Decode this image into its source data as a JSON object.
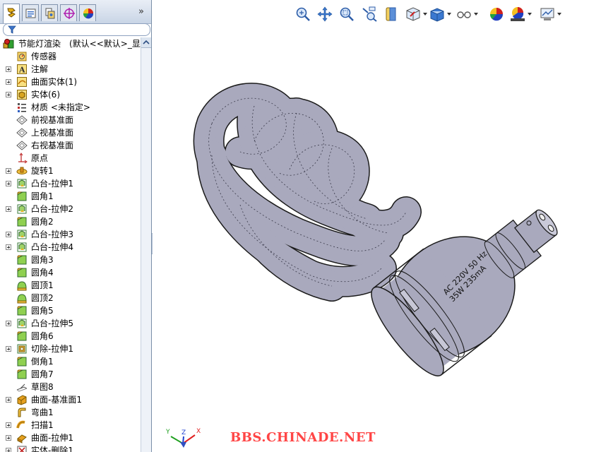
{
  "feature_manager": {
    "tabs": [
      {
        "name": "feature-manager-tab",
        "icon": "feature-tree-icon"
      },
      {
        "name": "property-manager-tab",
        "icon": "property-icon"
      },
      {
        "name": "configuration-manager-tab",
        "icon": "configuration-icon"
      },
      {
        "name": "dimxpert-tab",
        "icon": "target-icon"
      },
      {
        "name": "display-manager-tab",
        "icon": "appearance-icon"
      }
    ],
    "more_label": "»",
    "root_label": "节能灯渲染　(默认<<默认>_显示",
    "items": [
      {
        "label": "传感器",
        "icon": "sensor-icon",
        "expand": false
      },
      {
        "label": "注解",
        "icon": "annotation-icon",
        "expand": true
      },
      {
        "label": "曲面实体(1)",
        "icon": "surface-body-icon",
        "expand": true
      },
      {
        "label": "实体(6)",
        "icon": "solid-body-icon",
        "expand": true
      },
      {
        "label": "材质 <未指定>",
        "icon": "material-icon",
        "expand": false
      },
      {
        "label": "前视基准面",
        "icon": "plane-icon",
        "expand": false
      },
      {
        "label": "上视基准面",
        "icon": "plane-icon",
        "expand": false
      },
      {
        "label": "右视基准面",
        "icon": "plane-icon",
        "expand": false
      },
      {
        "label": "原点",
        "icon": "origin-icon",
        "expand": false
      },
      {
        "label": "旋转1",
        "icon": "revolve-icon",
        "expand": true
      },
      {
        "label": "凸台-拉伸1",
        "icon": "extrude-icon",
        "expand": true
      },
      {
        "label": "圆角1",
        "icon": "fillet-icon",
        "expand": false
      },
      {
        "label": "凸台-拉伸2",
        "icon": "extrude-icon",
        "expand": true
      },
      {
        "label": "圆角2",
        "icon": "fillet-icon",
        "expand": false
      },
      {
        "label": "凸台-拉伸3",
        "icon": "extrude-icon",
        "expand": true
      },
      {
        "label": "凸台-拉伸4",
        "icon": "extrude-icon",
        "expand": true
      },
      {
        "label": "圆角3",
        "icon": "fillet-icon",
        "expand": false
      },
      {
        "label": "圆角4",
        "icon": "fillet-icon",
        "expand": false
      },
      {
        "label": "圆顶1",
        "icon": "dome-icon",
        "expand": false
      },
      {
        "label": "圆顶2",
        "icon": "dome-icon",
        "expand": false
      },
      {
        "label": "圆角5",
        "icon": "fillet-icon",
        "expand": false
      },
      {
        "label": "凸台-拉伸5",
        "icon": "extrude-icon",
        "expand": true
      },
      {
        "label": "圆角6",
        "icon": "fillet-icon",
        "expand": false
      },
      {
        "label": "切除-拉伸1",
        "icon": "cut-extrude-icon",
        "expand": true
      },
      {
        "label": "倒角1",
        "icon": "fillet-icon",
        "expand": false
      },
      {
        "label": "圆角7",
        "icon": "fillet-icon",
        "expand": false
      },
      {
        "label": "草图8",
        "icon": "sketch-icon",
        "expand": false
      },
      {
        "label": "曲面-基准面1",
        "icon": "surface-plane-icon",
        "expand": true
      },
      {
        "label": "弯曲1",
        "icon": "flex-icon",
        "expand": false
      },
      {
        "label": "扫描1",
        "icon": "sweep-icon",
        "expand": true
      },
      {
        "label": "曲面-拉伸1",
        "icon": "surface-extrude-icon",
        "expand": true
      },
      {
        "label": "实体-删除1",
        "icon": "delete-body-icon",
        "expand": true
      }
    ]
  },
  "view_toolbar": [
    {
      "name": "zoom-to-fit-button",
      "icon": "zoom-to-fit-icon",
      "dropdown": false
    },
    {
      "name": "pan-button",
      "icon": "pan-icon",
      "dropdown": false
    },
    {
      "name": "zoom-to-area-button",
      "icon": "zoom-to-area-icon",
      "dropdown": false
    },
    {
      "name": "previous-view-button",
      "icon": "previous-view-icon",
      "dropdown": false
    },
    {
      "name": "section-view-button",
      "icon": "section-view-icon",
      "dropdown": false
    },
    {
      "name": "view-orientation-button",
      "icon": "view-orientation-icon",
      "dropdown": true
    },
    {
      "name": "display-style-button",
      "icon": "display-style-icon",
      "dropdown": true
    },
    {
      "name": "hide-show-items-button",
      "icon": "hide-show-icon",
      "dropdown": true
    },
    {
      "name": "edit-appearance-button",
      "icon": "appearance-ball-icon",
      "dropdown": false
    },
    {
      "name": "apply-scene-button",
      "icon": "scene-icon",
      "dropdown": true
    },
    {
      "name": "view-settings-button",
      "icon": "view-settings-icon",
      "dropdown": true
    }
  ],
  "model": {
    "label_line1": "AC 220V 50 Hz",
    "label_line2": "35W 235mA",
    "body_color": "#a9a9bd",
    "edge_color": "#1a1a1a"
  },
  "watermark": "BBS.CHINADE.NET",
  "triad": {
    "x": "X",
    "y": "Y",
    "z": "Z"
  }
}
